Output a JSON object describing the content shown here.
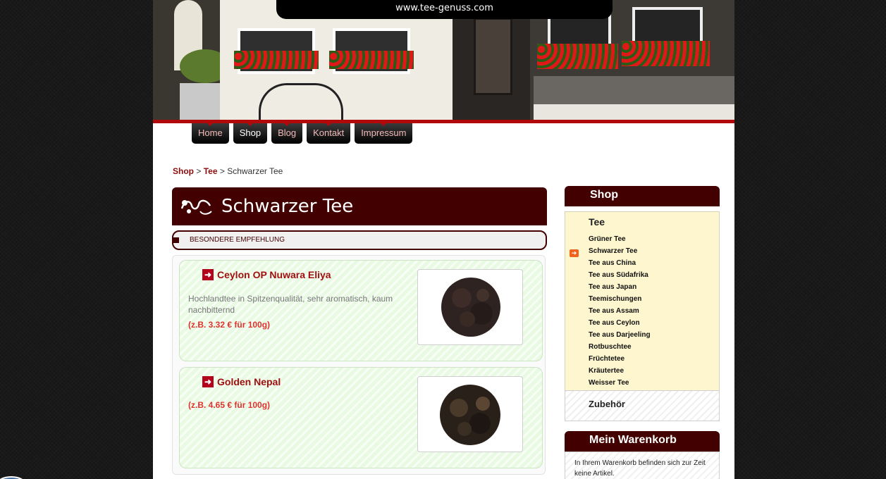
{
  "header": {
    "url": "www.tee-genuss.com"
  },
  "nav": {
    "items": [
      {
        "label": "Home"
      },
      {
        "label": "Shop"
      },
      {
        "label": "Blog"
      },
      {
        "label": "Kontakt"
      },
      {
        "label": "Impressum"
      }
    ],
    "active": "Shop"
  },
  "breadcrumb": {
    "level1": "Shop",
    "sep": ">",
    "level2": "Tee",
    "current": "Schwarzer Tee"
  },
  "main": {
    "title": "Schwarzer Tee",
    "recommendation": "BESONDERE EMPFEHLUNG",
    "products": [
      {
        "name": "Ceylon OP Nuwara Eliya",
        "description": "Hochlandtee in Spitzenqualität, sehr aromatisch, kaum nachbitternd",
        "price": "(z.B. 3.32 € für 100g)"
      },
      {
        "name": "Golden Nepal",
        "description": "",
        "price": "(z.B. 4.65 € für 100g)"
      }
    ]
  },
  "sidebar": {
    "shop": {
      "title": "Shop",
      "category": "Tee",
      "items": [
        "Grüner Tee",
        "Schwarzer Tee",
        "Tee aus China",
        "Tee aus Südafrika",
        "Tee aus Japan",
        "Teemischungen",
        "Tee aus Assam",
        "Tee aus Ceylon",
        "Tee aus Darjeeling",
        "Rotbuschtee",
        "Früchtetee",
        "Kräutertee",
        "Weisser Tee"
      ],
      "current": "Schwarzer Tee",
      "accessories": "Zubehör"
    },
    "cart": {
      "title": "Mein Warenkorb",
      "empty_text": "In Ihrem Warenkorb befinden sich zur Zeit keine Artikel."
    }
  },
  "colors": {
    "accent_dark": "#430000",
    "accent_red": "#b10909",
    "price_red": "#e0322e",
    "highlight_arrow": "#f1631d"
  },
  "icons": {
    "title_flourish": "flourish-icon",
    "product_arrow": "arrow-right-icon",
    "current_category": "current-arrow-icon"
  }
}
